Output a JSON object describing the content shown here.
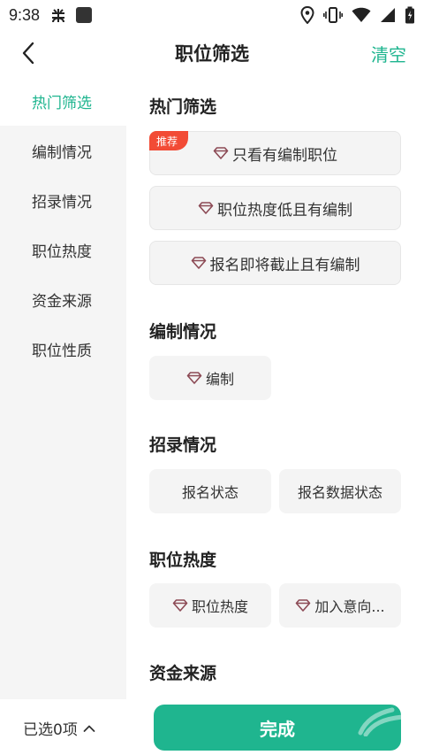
{
  "status": {
    "time": "9:38"
  },
  "header": {
    "title": "职位筛选",
    "clear_label": "清空"
  },
  "sidebar": {
    "items": [
      {
        "label": "热门筛选",
        "active": true
      },
      {
        "label": "编制情况"
      },
      {
        "label": "招录情况"
      },
      {
        "label": "职位热度"
      },
      {
        "label": "资金来源"
      },
      {
        "label": "职位性质"
      }
    ]
  },
  "sections": {
    "hot": {
      "title": "热门筛选",
      "badge": "推荐",
      "options": [
        "只看有编制职位",
        "职位热度低且有编制",
        "报名即将截止且有编制"
      ]
    },
    "bianzhi": {
      "title": "编制情况",
      "options": [
        "编制"
      ]
    },
    "zhaolu": {
      "title": "招录情况",
      "options": [
        "报名状态",
        "报名数据状态"
      ]
    },
    "redu": {
      "title": "职位热度",
      "options": [
        "职位热度",
        "加入意向..."
      ]
    },
    "zijin": {
      "title": "资金来源"
    }
  },
  "bottom": {
    "selected_label": "已选0项",
    "done_label": "完成"
  },
  "colors": {
    "accent": "#1fb58f",
    "badge": "#f24b35",
    "gem": "#8c4a55"
  }
}
